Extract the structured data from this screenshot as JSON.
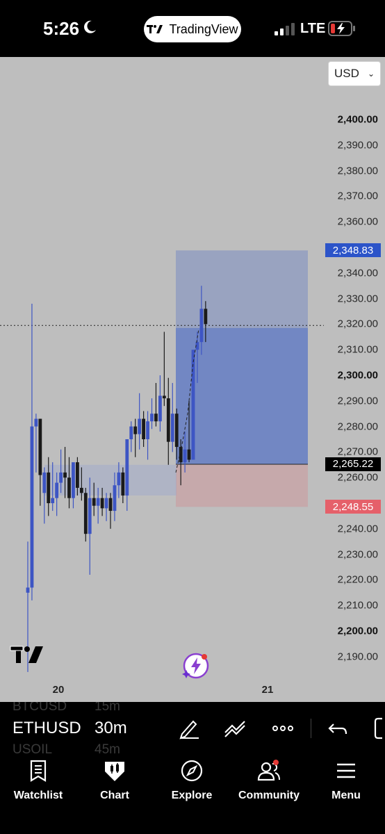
{
  "status_bar": {
    "time": "5:26",
    "app_pill": "TradingView",
    "network": "LTE"
  },
  "chart": {
    "currency": "USD",
    "price_axis": [
      {
        "label": "2,400.00",
        "value": 2400,
        "bold": true
      },
      {
        "label": "2,390.00",
        "value": 2390
      },
      {
        "label": "2,380.00",
        "value": 2380
      },
      {
        "label": "2,370.00",
        "value": 2370
      },
      {
        "label": "2,360.00",
        "value": 2360
      },
      {
        "label": "2,340.00",
        "value": 2340
      },
      {
        "label": "2,330.00",
        "value": 2330
      },
      {
        "label": "2,320.00",
        "value": 2320
      },
      {
        "label": "2,310.00",
        "value": 2310
      },
      {
        "label": "2,300.00",
        "value": 2300,
        "bold": true
      },
      {
        "label": "2,290.00",
        "value": 2290
      },
      {
        "label": "2,280.00",
        "value": 2280
      },
      {
        "label": "2,270.00",
        "value": 2270
      },
      {
        "label": "2,260.00",
        "value": 2260
      },
      {
        "label": "2,240.00",
        "value": 2240
      },
      {
        "label": "2,230.00",
        "value": 2230
      },
      {
        "label": "2,220.00",
        "value": 2220
      },
      {
        "label": "2,210.00",
        "value": 2210
      },
      {
        "label": "2,200.00",
        "value": 2200,
        "bold": true
      },
      {
        "label": "2,190.00",
        "value": 2190
      }
    ],
    "tags": {
      "take_profit": "2,348.83",
      "current_price": "2,265.22",
      "stop_loss": "2,248.55"
    },
    "time_labels": [
      "20",
      "21"
    ],
    "colors": {
      "up": "#3d55c4",
      "down": "#1a1a1a",
      "profit_zone": "#2c54c9",
      "loss_zone": "#e5606a"
    }
  },
  "chart_data": {
    "type": "candlestick",
    "symbol": "ETHUSD",
    "timeframe": "30m",
    "ylim": [
      2185,
      2410
    ],
    "x_labels": [
      "20",
      "21"
    ],
    "position": {
      "type": "long",
      "entry": 2265.22,
      "take_profit": 2348.83,
      "stop_loss": 2248.55
    },
    "candles": [
      {
        "o": 2215,
        "h": 2235,
        "l": 2184,
        "c": 2217
      },
      {
        "o": 2217,
        "h": 2328,
        "l": 2212,
        "c": 2280
      },
      {
        "o": 2280,
        "h": 2285,
        "l": 2262,
        "c": 2283
      },
      {
        "o": 2283,
        "h": 2283,
        "l": 2249,
        "c": 2261
      },
      {
        "o": 2254,
        "h": 2264,
        "l": 2242,
        "c": 2262
      },
      {
        "o": 2262,
        "h": 2268,
        "l": 2245,
        "c": 2250
      },
      {
        "o": 2250,
        "h": 2266,
        "l": 2247,
        "c": 2252
      },
      {
        "o": 2252,
        "h": 2262,
        "l": 2245,
        "c": 2258
      },
      {
        "o": 2258,
        "h": 2271,
        "l": 2254,
        "c": 2262
      },
      {
        "o": 2262,
        "h": 2272,
        "l": 2252,
        "c": 2260
      },
      {
        "o": 2260,
        "h": 2268,
        "l": 2248,
        "c": 2252
      },
      {
        "o": 2252,
        "h": 2265,
        "l": 2248,
        "c": 2266
      },
      {
        "o": 2266,
        "h": 2268,
        "l": 2253,
        "c": 2256
      },
      {
        "o": 2256,
        "h": 2264,
        "l": 2251,
        "c": 2254
      },
      {
        "o": 2254,
        "h": 2256,
        "l": 2235,
        "c": 2238
      },
      {
        "o": 2238,
        "h": 2260,
        "l": 2222,
        "c": 2252
      },
      {
        "o": 2252,
        "h": 2258,
        "l": 2245,
        "c": 2249
      },
      {
        "o": 2249,
        "h": 2256,
        "l": 2242,
        "c": 2252
      },
      {
        "o": 2252,
        "h": 2256,
        "l": 2245,
        "c": 2248
      },
      {
        "o": 2248,
        "h": 2254,
        "l": 2243,
        "c": 2252
      },
      {
        "o": 2252,
        "h": 2254,
        "l": 2240,
        "c": 2247
      },
      {
        "o": 2247,
        "h": 2262,
        "l": 2243,
        "c": 2257
      },
      {
        "o": 2257,
        "h": 2266,
        "l": 2252,
        "c": 2262
      },
      {
        "o": 2262,
        "h": 2264,
        "l": 2250,
        "c": 2253
      },
      {
        "o": 2253,
        "h": 2264,
        "l": 2247,
        "c": 2275
      },
      {
        "o": 2275,
        "h": 2282,
        "l": 2270,
        "c": 2280
      },
      {
        "o": 2280,
        "h": 2283,
        "l": 2268,
        "c": 2277
      },
      {
        "o": 2277,
        "h": 2293,
        "l": 2271,
        "c": 2283
      },
      {
        "o": 2283,
        "h": 2286,
        "l": 2272,
        "c": 2275
      },
      {
        "o": 2275,
        "h": 2286,
        "l": 2267,
        "c": 2282
      },
      {
        "o": 2282,
        "h": 2291,
        "l": 2279,
        "c": 2285
      },
      {
        "o": 2285,
        "h": 2297,
        "l": 2280,
        "c": 2282
      },
      {
        "o": 2282,
        "h": 2300,
        "l": 2278,
        "c": 2292
      },
      {
        "o": 2292,
        "h": 2317,
        "l": 2288,
        "c": 2291
      },
      {
        "o": 2291,
        "h": 2299,
        "l": 2265,
        "c": 2274
      },
      {
        "o": 2274,
        "h": 2297,
        "l": 2270,
        "c": 2285
      },
      {
        "o": 2285,
        "h": 2287,
        "l": 2267,
        "c": 2272
      },
      {
        "o": 2272,
        "h": 2275,
        "l": 2257,
        "c": 2266
      },
      {
        "o": 2266,
        "h": 2278,
        "l": 2262,
        "c": 2271
      },
      {
        "o": 2271,
        "h": 2290,
        "l": 2266,
        "c": 2267
      },
      {
        "o": 2267,
        "h": 2286,
        "l": 2268,
        "c": 2310
      },
      {
        "o": 2310,
        "h": 2317,
        "l": 2297,
        "c": 2313
      },
      {
        "o": 2313,
        "h": 2335,
        "l": 2308,
        "c": 2326
      },
      {
        "o": 2326,
        "h": 2329,
        "l": 2313,
        "c": 2320
      }
    ]
  },
  "symbol_bar": {
    "ghost_above": [
      "BTCUSD",
      "15m"
    ],
    "symbol": "ETHUSD",
    "timeframe": "30m",
    "ghost_below": [
      "USOIL",
      "45m"
    ]
  },
  "nav": {
    "watchlist": "Watchlist",
    "chart": "Chart",
    "explore": "Explore",
    "community": "Community",
    "menu": "Menu"
  }
}
